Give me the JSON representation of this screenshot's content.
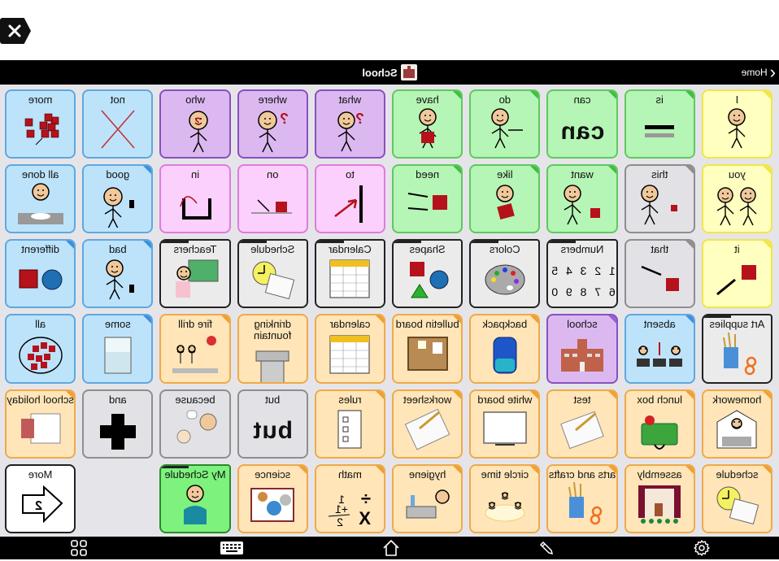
{
  "topbar": {
    "close_icon": "close-icon"
  },
  "navbar": {
    "home_label": "Home",
    "board_title": "School"
  },
  "colors": {
    "yellow": "#ffffc0",
    "green": "#b5f5b5",
    "purple": "#dcb8f0",
    "blue": "#bde3fb",
    "pink": "#fcd0fc",
    "gray": "#e2e2e6",
    "folder": "#ebebeb",
    "orange": "#ffe5b8",
    "white": "#ffffff",
    "brightgreen": "#7df27d"
  },
  "grid": {
    "rows": [
      [
        {
          "label": "I",
          "color": "yellow",
          "corner": "#f0e64a",
          "icon": "person-pointing-self"
        },
        {
          "label": "is",
          "color": "green",
          "corner": "#3fbf3f",
          "icon": "equals-sign"
        },
        {
          "label": "can",
          "color": "green",
          "corner": "#3fbf3f",
          "text_symbol": "can"
        },
        {
          "label": "do",
          "color": "green",
          "corner": "#3fbf3f",
          "icon": "person-doing"
        },
        {
          "label": "have",
          "color": "green",
          "corner": "#3fbf3f",
          "icon": "person-holding-box"
        },
        {
          "label": "what",
          "color": "purple",
          "icon": "person-question"
        },
        {
          "label": "where",
          "color": "purple",
          "icon": "person-looking-question"
        },
        {
          "label": "who",
          "color": "purple",
          "icon": "face-question"
        },
        {
          "label": "not",
          "color": "blue",
          "icon": "red-x"
        },
        {
          "label": "more",
          "color": "blue",
          "icon": "red-squares-more"
        }
      ],
      [
        {
          "label": "you",
          "color": "yellow",
          "corner": "#f0e64a",
          "icon": "two-people-pointing"
        },
        {
          "label": "this",
          "color": "gray",
          "corner": "#8e8e8e",
          "icon": "person-pointing-near"
        },
        {
          "label": "want",
          "color": "green",
          "corner": "#3fbf3f",
          "icon": "person-reaching"
        },
        {
          "label": "like",
          "color": "green",
          "corner": "#3fbf3f",
          "icon": "person-hugging-box"
        },
        {
          "label": "need",
          "color": "green",
          "corner": "#3fbf3f",
          "icon": "hands-reaching-box"
        },
        {
          "label": "to",
          "color": "pink",
          "icon": "arrow-to-line"
        },
        {
          "label": "on",
          "color": "pink",
          "icon": "box-on-surface"
        },
        {
          "label": "in",
          "color": "pink",
          "icon": "arrow-into-container"
        },
        {
          "label": "good",
          "color": "blue",
          "corner": "#3b8fe0",
          "icon": "thumbs-up-person"
        },
        {
          "label": "all done",
          "color": "blue",
          "icon": "person-all-done"
        }
      ],
      [
        {
          "label": "it",
          "color": "yellow",
          "corner": "#f0e64a",
          "icon": "hand-pointing-box"
        },
        {
          "label": "that",
          "color": "gray",
          "corner": "#8e8e8e",
          "icon": "hand-pointing-far"
        },
        {
          "label": "Numbers",
          "color": "folder",
          "folder": true,
          "numbers": "1 2 3 4 5\n6 7 8 9 0"
        },
        {
          "label": "Colors",
          "color": "folder",
          "folder": true,
          "icon": "paint-palette"
        },
        {
          "label": "Shapes",
          "color": "folder",
          "folder": true,
          "icon": "shapes"
        },
        {
          "label": "Calendar",
          "color": "folder",
          "folder": true,
          "icon": "calendar"
        },
        {
          "label": "Schedule",
          "color": "folder",
          "folder": true,
          "icon": "schedule-clock"
        },
        {
          "label": "Teachers",
          "color": "folder",
          "folder": true,
          "icon": "teacher-board"
        },
        {
          "label": "bad",
          "color": "blue",
          "corner": "#3b8fe0",
          "icon": "thumbs-down-person"
        },
        {
          "label": "different",
          "color": "blue",
          "corner": "#3b8fe0",
          "icon": "circle-and-square"
        }
      ],
      [
        {
          "label": "Art supplies",
          "color": "folder",
          "folder": true,
          "icon": "art-supplies"
        },
        {
          "label": "absent",
          "color": "blue",
          "corner": "#3b8fe0",
          "icon": "absent-desks"
        },
        {
          "label": "school",
          "color": "purple",
          "corner": "#9b5fd0",
          "icon": "school-building"
        },
        {
          "label": "backpack",
          "color": "orange",
          "corner": "#f0a030",
          "icon": "backpack"
        },
        {
          "label": "bulletin board",
          "color": "orange",
          "corner": "#f0a030",
          "icon": "bulletin-board"
        },
        {
          "label": "calendar",
          "color": "orange",
          "corner": "#f0a030",
          "icon": "calendar"
        },
        {
          "label": "drinking fountain",
          "color": "orange",
          "icon": "drinking-fountain"
        },
        {
          "label": "fire drill",
          "color": "orange",
          "corner": "#f0a030",
          "icon": "fire-drill"
        },
        {
          "label": "some",
          "color": "blue",
          "corner": "#3b8fe0",
          "icon": "glass-some"
        },
        {
          "label": "all",
          "color": "blue",
          "icon": "red-squares-all"
        }
      ],
      [
        {
          "label": "homework",
          "color": "orange",
          "corner": "#f0a030",
          "icon": "homework"
        },
        {
          "label": "lunch box",
          "color": "orange",
          "corner": "#f0a030",
          "icon": "lunch-box"
        },
        {
          "label": "test",
          "color": "orange",
          "corner": "#f0a030",
          "icon": "test-paper"
        },
        {
          "label": "white board",
          "color": "orange",
          "corner": "#f0a030",
          "icon": "white-board"
        },
        {
          "label": "worksheet",
          "color": "orange",
          "corner": "#f0a030",
          "icon": "worksheet"
        },
        {
          "label": "rules",
          "color": "orange",
          "corner": "#f0a030",
          "icon": "rules-checklist"
        },
        {
          "label": "but",
          "color": "gray",
          "text_symbol": "but"
        },
        {
          "label": "because",
          "color": "gray",
          "icon": "because-faces"
        },
        {
          "label": "and",
          "color": "gray",
          "icon": "plus-sign"
        },
        {
          "label": "school holiday",
          "color": "orange",
          "corner": "#f0a030",
          "icon": "school-holiday"
        }
      ],
      [
        {
          "label": "schedule",
          "color": "orange",
          "corner": "#f0a030",
          "icon": "schedule-clock"
        },
        {
          "label": "assembly",
          "color": "orange",
          "corner": "#f0a030",
          "icon": "assembly-stage"
        },
        {
          "label": "arts and crafts",
          "color": "orange",
          "corner": "#f0a030",
          "icon": "art-supplies"
        },
        {
          "label": "circle time",
          "color": "orange",
          "corner": "#f0a030",
          "icon": "circle-time"
        },
        {
          "label": "hygiene",
          "color": "orange",
          "corner": "#f0a030",
          "icon": "hygiene-sink"
        },
        {
          "label": "math",
          "color": "orange",
          "corner": "#f0a030",
          "icon": "math-symbols"
        },
        {
          "label": "science",
          "color": "orange",
          "corner": "#f0a030",
          "icon": "science-book"
        },
        {
          "label": "My Schedule",
          "color": "brightgreen",
          "folder": true,
          "icon": "person-signing"
        },
        null,
        {
          "label": "More",
          "color": "white",
          "icon": "back-arrow-2",
          "arrow_number": "2"
        }
      ]
    ]
  },
  "bottombar": {
    "items": [
      {
        "name": "apps-grid-icon"
      },
      {
        "name": "keyboard-icon"
      },
      {
        "name": "home-icon"
      },
      {
        "name": "pencil-icon"
      },
      {
        "name": "gear-icon"
      }
    ]
  }
}
